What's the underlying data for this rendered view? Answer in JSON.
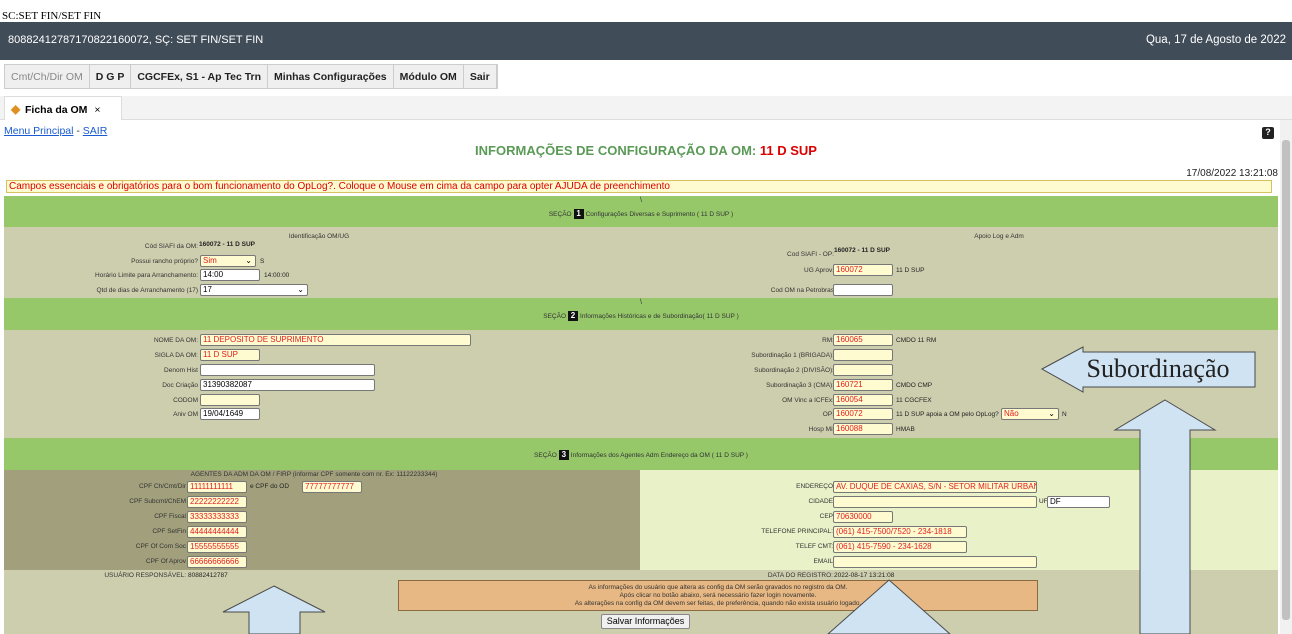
{
  "window": {
    "top_text": "SC:SET FIN/SET FIN"
  },
  "header": {
    "user": "80882412787170822160072, SÇ: SET FIN/SET FIN",
    "date": "Qua, 17 de Agosto de 2022"
  },
  "menu": {
    "items": [
      "Cmt/Ch/Dir OM",
      "D G P",
      "CGCFEx, S1 - Ap Tec Trn",
      "Minhas Configurações",
      "Módulo OM",
      "Sair"
    ]
  },
  "tab": {
    "label": "Ficha da OM",
    "close": "×"
  },
  "links": {
    "menu_principal": "Menu Principal",
    "sep": " - ",
    "sair": "SAIR"
  },
  "help": {
    "label": "?"
  },
  "title": {
    "prefix": "INFORMAÇÕES DE CONFIGURAÇÃO DA OM:",
    "om": "11 D SUP"
  },
  "datetime": "17/08/2022 13:21:08",
  "warning": "Campos essenciais e obrigatórios para o bom funcionamento do OpLog?. Coloque o Mouse em cima da campo para opter AJUDA de preenchimento",
  "sec1": {
    "slash": "\\",
    "prefix": "SEÇÃO",
    "num": "1",
    "caption": "Configurações Diversas e Suprimento ( 11 D SUP )",
    "left_head": "Identificação OM/UG",
    "right_head": "Apoio Log e Adm",
    "cod_siafi_lbl": "Cód SIAFI da OM:",
    "cod_siafi_val": "160072 - 11 D SUP",
    "rancho_lbl": "Possui rancho próprio?",
    "rancho_val": "Sim",
    "rancho_suffix": "S",
    "horario_lbl": "Horário Limite para Arranchamento:",
    "horario_val": "14:00",
    "horario_suffix": "14:00:00",
    "qtd_lbl": "Qtd de dias de Arranchamento (17)",
    "qtd_val": "17",
    "cod_siafi_op_lbl": "Cod SIAFI - OP:",
    "cod_siafi_op_val": "160072 - 11 D SUP",
    "ug_lbl": "UG Aprov:",
    "ug_val": "160072",
    "ug_suffix": "11 D SUP",
    "petro_lbl": "Cod OM na Petrobras",
    "petro_val": ""
  },
  "sec2": {
    "slash": "\\",
    "prefix": "SEÇÃO",
    "num": "2",
    "caption": "Informações Históricas e de Subordinação( 11 D SUP )",
    "nome_lbl": "NOME DA OM:",
    "nome_val": "11 DEPOSITO DE SUPRIMENTO",
    "sigla_lbl": "SIGLA DA OM:",
    "sigla_val": "11 D SUP",
    "denom_lbl": "Denom Hist",
    "denom_val": "",
    "doc_lbl": "Doc Criação",
    "doc_val": "31390382087",
    "codom_lbl": "CODOM",
    "codom_val": "",
    "aniv_lbl": "Aniv OM",
    "aniv_val": "19/04/1649",
    "rm_lbl": "RM:",
    "rm_val": "160065",
    "rm_suffix": "CMDO 11 RM",
    "sub1_lbl": "Subordinação 1 (BRIGADA):",
    "sub1_val": "",
    "sub2_lbl": "Subordinação 2 (DIVISÃO):",
    "sub2_val": "",
    "sub3_lbl": "Subordinação 3 (CMA):",
    "sub3_val": "160721",
    "sub3_suffix": "CMDO CMP",
    "omvinc_lbl": "OM Vinc a ICFEx:",
    "omvinc_val": "160054",
    "omvinc_suffix": "11 CGCFEX",
    "op_lbl": "OP:",
    "op_val": "160072",
    "op_suffix": "11 D SUP apoia a OM pelo OpLog?",
    "op_sel": "Não",
    "op_sel_suffix": "N",
    "hosp_lbl": "Hosp Mil",
    "hosp_val": "160088",
    "hosp_suffix": "HMAB"
  },
  "sec3": {
    "prefix": "SEÇÃO",
    "num": "3",
    "caption": "Informações dos Agentes Adm Endereço da OM ( 11 D SUP )",
    "agents_head": "AGENTES DA ADM DA OM / FIRP (informar CPF somente com nr. Ex: 11122233344)",
    "cpf_ch_lbl": "CPF Ch/Cmt/Dir",
    "cpf_ch_val": "11111111111",
    "cpf_od_lbl": "e CPF do OD",
    "cpf_od_val": "77777777777",
    "cpf_subcmt_lbl": "CPF Subcmt/ChEM",
    "cpf_subcmt_val": "22222222222",
    "cpf_fiscal_lbl": "CPF Fiscal",
    "cpf_fiscal_val": "33333333333",
    "cpf_setfin_lbl": "CPF SetFin",
    "cpf_setfin_val": "44444444444",
    "cpf_comsoc_lbl": "CPF Of Com Soc",
    "cpf_comsoc_val": "15555555555",
    "cpf_aprov_lbl": "CPF Of Aprov",
    "cpf_aprov_val": "66666666666",
    "usuario_lbl": "USUÁRIO RESPONSÁVEL:",
    "usuario_val": "80882412787",
    "end_lbl": "ENDEREÇO",
    "end_val": "AV. DUQUE DE CAXIAS, S/N - SETOR MILITAR URBANO",
    "cidade_lbl": "CIDADE",
    "cidade_val": "",
    "uf_lbl": "UF",
    "uf_val": "DF",
    "cep_lbl": "CEP",
    "cep_val": "70630000",
    "tel_lbl": "TELEFONE PRINCIPAL:",
    "tel_val": "(061) 415-7500/7520 - 234-1818",
    "telcmt_lbl": "TELEF CMT:",
    "telcmt_val": "(061) 415-7590 - 234-1628",
    "email_lbl": "EMAIL",
    "email_val": "",
    "data_lbl": "DATA DO REGISTRO:",
    "data_val": "2022-08-17 13:21:08"
  },
  "note": {
    "line1": "As informações do usuário que altera as config da OM serão gravados no registro da OM.",
    "line2": "Após clicar no botão abaixo, será necessário fazer login novamente.",
    "line3": "As alterações na config da OM devem ser feitas, de preferência, quando não exista usuário logado."
  },
  "save_button": "Salvar Informações",
  "callout": {
    "label": "Subordinação"
  },
  "colors": {
    "header": "#414c59",
    "section": "#96c86a",
    "form_bg": "#cdceae",
    "callout": "#cfe3f3",
    "required": "#e02020"
  }
}
